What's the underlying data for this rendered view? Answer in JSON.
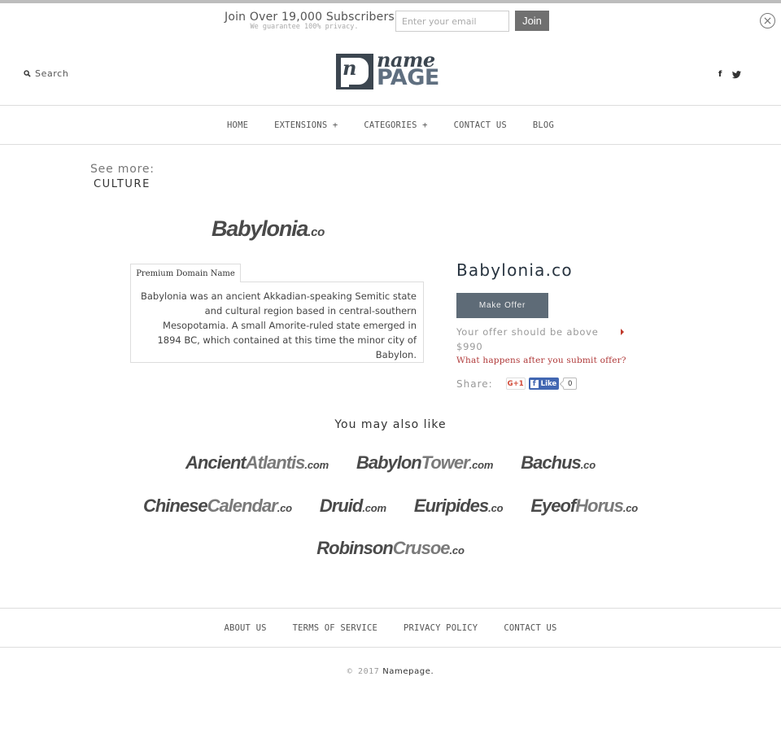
{
  "subscribe": {
    "title": "Join Over 19,000 Subscribers",
    "note": "We guarantee 100% privacy.",
    "email_placeholder": "Enter your email",
    "email_value": "",
    "join_label": "Join",
    "close_icon": "close-circle-icon"
  },
  "header": {
    "search_label": "Search",
    "search_icon": "search-icon",
    "logo": {
      "line1": "name",
      "line2": "PAGE",
      "mark": "n"
    },
    "social": [
      {
        "name": "facebook",
        "glyph": "f"
      },
      {
        "name": "twitter",
        "glyph": "twitter-bird"
      }
    ]
  },
  "nav": {
    "items": [
      {
        "label": "HOME"
      },
      {
        "label": "EXTENSIONS +"
      },
      {
        "label": "CATEGORIES +"
      },
      {
        "label": "CONTACT US"
      },
      {
        "label": "BLOG"
      }
    ]
  },
  "see_more": {
    "label": "See more:",
    "category": "CULTURE"
  },
  "domain": {
    "logo_name": "Babylonia",
    "logo_ext": ".co",
    "title": "Babylonia.co",
    "tab_label": "Premium Domain Name",
    "description": "Babylonia was an ancient Akkadian-speaking Semitic state and cultural region based in central-southern Mesopotamia. A small Amorite-ruled state emerged in 1894 BC, which contained at this time the minor city of Babylon.",
    "make_offer_label": "Make Offer",
    "offer_min_text": "Your offer should be above $990",
    "what_happens_link": "What happens after you submit offer?",
    "share_label": "Share:",
    "gplus_label": "G+1",
    "fb_like_label": "Like",
    "fb_like_count": "0"
  },
  "also_like": {
    "title": "You may also like",
    "rows": [
      [
        {
          "a": "Ancient",
          "b": "Atlantis",
          "ext": ".com"
        },
        {
          "a": "Babylon",
          "b": "Tower",
          "ext": ".com"
        },
        {
          "a": "Bachus",
          "b": "",
          "ext": ".co"
        }
      ],
      [
        {
          "a": "Chinese",
          "b": "Calendar",
          "ext": ".co"
        },
        {
          "a": "Druid",
          "b": "",
          "ext": ".com"
        },
        {
          "a": "Euripides",
          "b": "",
          "ext": ".co"
        },
        {
          "a": "Eyeof",
          "b": "Horus",
          "ext": ".co"
        }
      ],
      [
        {
          "a": "Robinson",
          "b": "Crusoe",
          "ext": ".co"
        }
      ]
    ]
  },
  "footer": {
    "links": [
      {
        "label": "ABOUT US"
      },
      {
        "label": "TERMS OF SERVICE"
      },
      {
        "label": "PRIVACY POLICY"
      },
      {
        "label": "CONTACT US"
      }
    ],
    "copyright_prefix": "© 2017",
    "copyright_brand": "Namepage."
  }
}
